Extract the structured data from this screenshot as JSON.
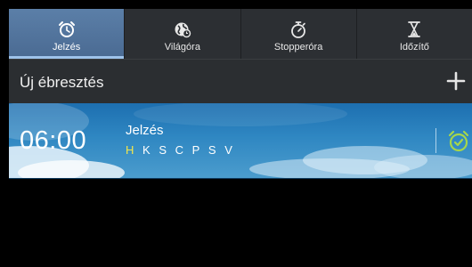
{
  "tabs": [
    {
      "label": "Jelzés",
      "icon": "alarm-clock-icon",
      "active": true
    },
    {
      "label": "Világóra",
      "icon": "globe-clock-icon",
      "active": false
    },
    {
      "label": "Stopperóra",
      "icon": "stopwatch-icon",
      "active": false
    },
    {
      "label": "Időzítő",
      "icon": "hourglass-icon",
      "active": false
    }
  ],
  "header": {
    "title": "Új ébresztés",
    "add_icon": "plus-icon"
  },
  "alarm": {
    "time": "06:00",
    "name": "Jelzés",
    "days": [
      "H",
      "K",
      "S",
      "C",
      "P",
      "S",
      "V"
    ],
    "active_days": [
      0
    ],
    "enabled": true,
    "toggle_icon": "alarm-toggle-icon"
  },
  "colors": {
    "active_tab": "#4a6a92",
    "tab_indicator": "#9ec3ea",
    "active_day": "#f6e84a",
    "toggle_on": "#a6d64a"
  }
}
